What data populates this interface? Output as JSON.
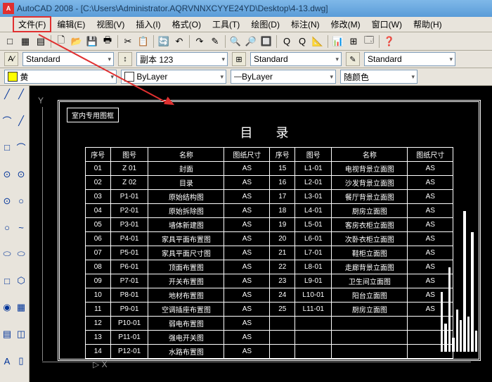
{
  "titlebar": {
    "icon_text": "A",
    "text": "AutoCAD 2008 - [C:\\Users\\Administrator.AQRVNNXCYYE24YD\\Desktop\\4-13.dwg]"
  },
  "menu": {
    "file": "文件(F)",
    "items": [
      "编辑(E)",
      "视图(V)",
      "插入(I)",
      "格式(O)",
      "工具(T)",
      "绘图(D)",
      "标注(N)",
      "修改(M)",
      "窗口(W)",
      "帮助(H)"
    ]
  },
  "toolbar1": [
    "□",
    "▦",
    "▤",
    "🗋",
    "📂",
    "💾",
    "🖶",
    "✂",
    "📋",
    "🔄",
    "↶",
    "↷",
    "✎",
    "🔍",
    "🔎",
    "🔲",
    "Q",
    "Q",
    "📐",
    "📊",
    "⊞",
    "🗔",
    "❓"
  ],
  "opts": {
    "style1": "Standard",
    "style2": "副本 123",
    "style3": "Standard",
    "style4": "Standard",
    "layer": "黄",
    "line1": "ByLayer",
    "line2": "ByLayer",
    "color_mode": "随颜色"
  },
  "left_tools": [
    "╱",
    "╱",
    "⌒",
    "╱",
    "□",
    "⌒",
    "⊙",
    "⊙",
    "⊙",
    "○",
    "○",
    "~",
    "⬭",
    "⬭",
    "□",
    "⬡",
    "◉",
    "▦",
    "▤",
    "◫",
    "A",
    "▯"
  ],
  "drawing": {
    "frame_tag": "室内专用图框",
    "title": "目 录",
    "headers": [
      "序号",
      "图号",
      "名称",
      "图纸尺寸",
      "序号",
      "图号",
      "名称",
      "图纸尺寸"
    ],
    "rows": [
      [
        "01",
        "Z 01",
        "封面",
        "AS",
        "15",
        "L1-01",
        "电视背景立面图",
        "AS"
      ],
      [
        "02",
        "Z 02",
        "目录",
        "AS",
        "16",
        "L2-01",
        "沙发背景立面图",
        "AS"
      ],
      [
        "03",
        "P1-01",
        "原始结构图",
        "AS",
        "17",
        "L3-01",
        "餐厅背景立面图",
        "AS"
      ],
      [
        "04",
        "P2-01",
        "原始拆除图",
        "AS",
        "18",
        "L4-01",
        "厨房立面图",
        "AS"
      ],
      [
        "05",
        "P3-01",
        "墙体新建图",
        "AS",
        "19",
        "L5-01",
        "客房衣柜立面图",
        "AS"
      ],
      [
        "06",
        "P4-01",
        "家具平面布置图",
        "AS",
        "20",
        "L6-01",
        "次卧衣柜立面图",
        "AS"
      ],
      [
        "07",
        "P5-01",
        "家具平面尺寸图",
        "AS",
        "21",
        "L7-01",
        "鞋柜立面图",
        "AS"
      ],
      [
        "08",
        "P6-01",
        "顶面布置图",
        "AS",
        "22",
        "L8-01",
        "走廊背景立面图",
        "AS"
      ],
      [
        "09",
        "P7-01",
        "开关布置图",
        "AS",
        "23",
        "L9-01",
        "卫生间立面图",
        "AS"
      ],
      [
        "10",
        "P8-01",
        "地材布置图",
        "AS",
        "24",
        "L10-01",
        "阳台立面图",
        "AS"
      ],
      [
        "11",
        "P9-01",
        "空调插座布置图",
        "AS",
        "25",
        "L11-01",
        "厨房立面图",
        "AS"
      ],
      [
        "12",
        "P10-01",
        "弱电布置图",
        "AS",
        "",
        "",
        "",
        ""
      ],
      [
        "13",
        "P11-01",
        "强电开关图",
        "AS",
        "",
        "",
        "",
        ""
      ],
      [
        "14",
        "P12-01",
        "水路布置图",
        "AS",
        "",
        "",
        "",
        ""
      ]
    ],
    "x_label": "X",
    "y_label": "Y"
  },
  "bars": [
    85,
    40,
    120,
    20,
    60,
    45,
    200,
    50,
    170,
    30
  ]
}
